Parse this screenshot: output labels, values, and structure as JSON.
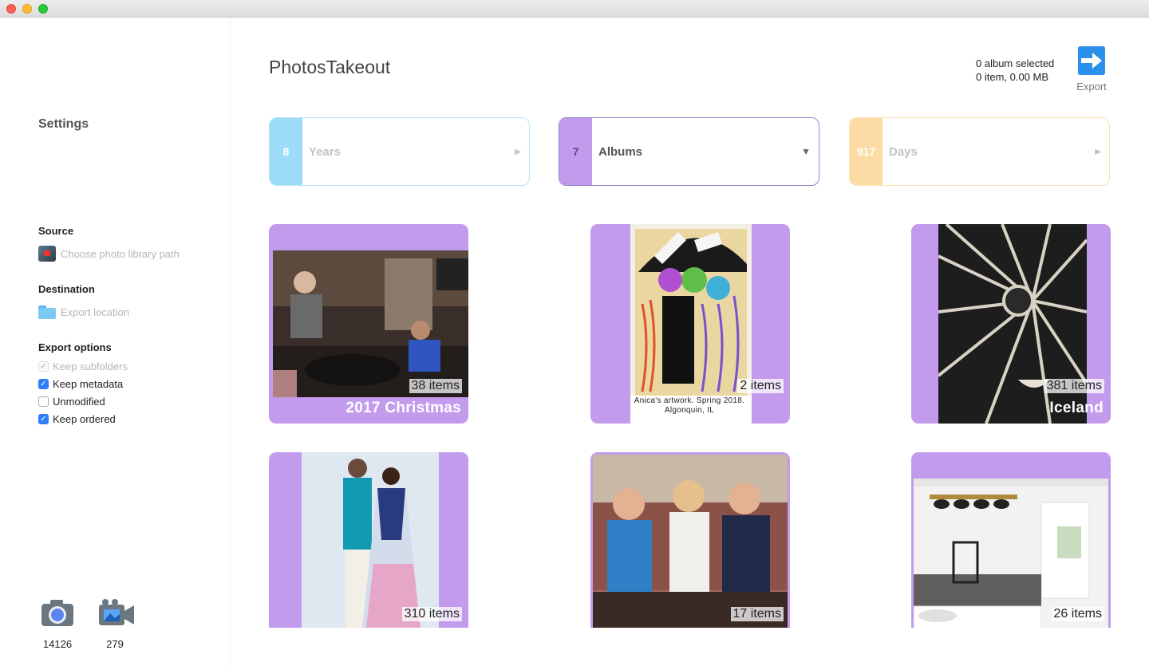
{
  "sidebar": {
    "title": "Settings",
    "source": {
      "label": "Source",
      "placeholder": "Choose photo library path",
      "icon": "photos-library-icon"
    },
    "destination": {
      "label": "Destination",
      "placeholder": "Export location",
      "icon": "folder-icon"
    },
    "export_options": {
      "label": "Export options",
      "items": [
        {
          "label": "Keep subfolders",
          "checked": true,
          "enabled": false
        },
        {
          "label": "Keep metadata",
          "checked": true,
          "enabled": true
        },
        {
          "label": "Unmodified",
          "checked": false,
          "enabled": true
        },
        {
          "label": "Keep ordered",
          "checked": true,
          "enabled": true
        }
      ]
    },
    "stats": {
      "photos": "14126",
      "videos": "279"
    }
  },
  "header": {
    "app_title": "PhotosTakeout",
    "selection_line1": "0 album selected",
    "selection_line2": "0 item, 0.00 MB",
    "export_label": "Export"
  },
  "segments": [
    {
      "count": "8",
      "name": "Years",
      "arrow": "▶",
      "color": "#9ddcf7",
      "border": "#b6e4f8",
      "active": false
    },
    {
      "count": "7",
      "name": "Albums",
      "arrow": "▼",
      "color": "#c29bed",
      "border": "#8f86c9",
      "active": true
    },
    {
      "count": "917",
      "name": "Days",
      "arrow": "▶",
      "color": "#fcdca4",
      "border": "#fbe3b6",
      "active": false
    }
  ],
  "albums": [
    {
      "count": "38 items",
      "title": "2017 Christmas"
    },
    {
      "count": "2 items",
      "title": "Anica's artwork. Spring 2018. Algonquin, IL"
    },
    {
      "count": "381 items",
      "title": "Iceland"
    },
    {
      "count": "310 items",
      "title": ""
    },
    {
      "count": "17 items",
      "title": ""
    },
    {
      "count": "26 items",
      "title": ""
    }
  ],
  "colors": {
    "accent": "#c29bed",
    "checkbox": "#2d7ff9"
  }
}
